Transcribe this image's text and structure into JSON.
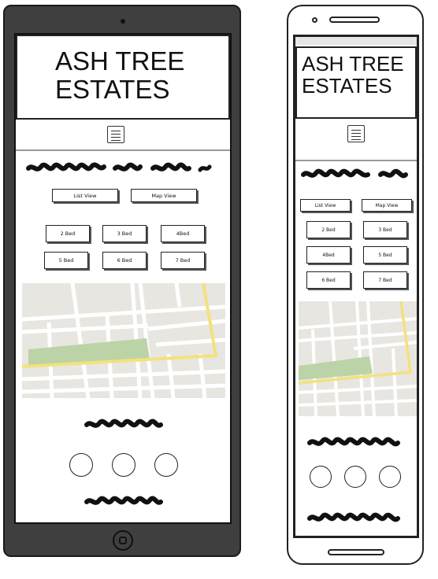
{
  "app": {
    "title": "ASH TREE\nESTATES"
  },
  "buttons": {
    "list_view": "List View",
    "map_view": "Map View"
  },
  "bed_filters": {
    "two_bed": "2 Bed",
    "three_bed": "3 Bed",
    "four_bed_tablet": "4Bed",
    "four_bed_phone": "4Bed",
    "five_bed": "5 Bed",
    "six_bed": "6 Bed",
    "seven_bed": "7 Bed"
  },
  "colors": {
    "map_background": "#e8e6e1",
    "map_roads": "#ffffff",
    "map_highway": "#f3e27c",
    "map_park": "#bcd3a7",
    "device_body": "#3f3f3f"
  },
  "icons": {
    "menu": "hamburger-menu-icon",
    "camera": "camera-icon",
    "home": "home-button-icon"
  }
}
